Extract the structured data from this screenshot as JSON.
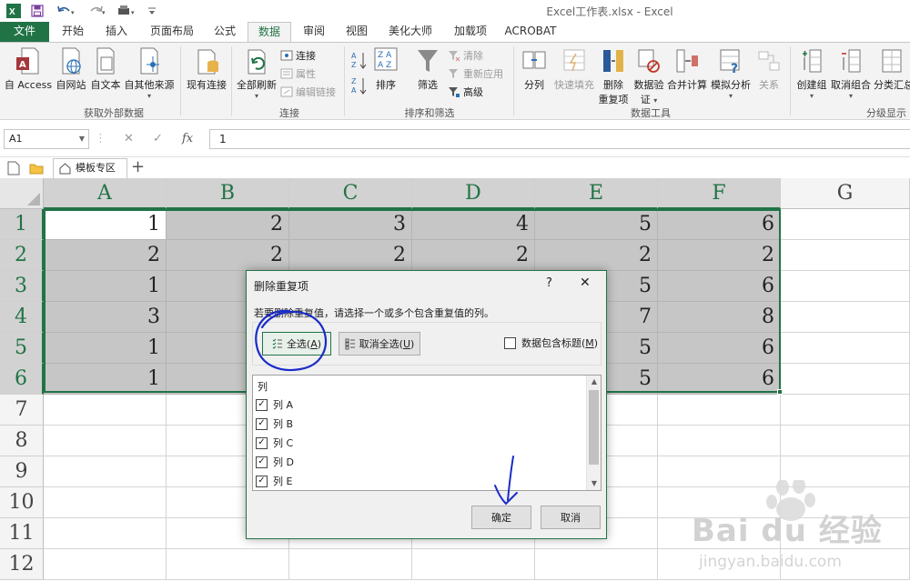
{
  "app": {
    "title": "Excel工作表.xlsx - Excel",
    "quick_access": [
      "save-icon",
      "undo-icon",
      "redo-icon",
      "print-preview-icon"
    ],
    "colors": {
      "brand": "#217346",
      "selection": "#c6c6c6",
      "annotation": "#1a2cc8"
    }
  },
  "ribbon_tabs": [
    {
      "label": "文件"
    },
    {
      "label": "开始"
    },
    {
      "label": "插入"
    },
    {
      "label": "页面布局"
    },
    {
      "label": "公式"
    },
    {
      "label": "数据",
      "active": true
    },
    {
      "label": "审阅"
    },
    {
      "label": "视图"
    },
    {
      "label": "美化大师"
    },
    {
      "label": "加载项"
    },
    {
      "label": "ACROBAT"
    }
  ],
  "ribbon": {
    "get_external": {
      "label": "获取外部数据",
      "buttons": [
        "自 Access",
        "自网站",
        "自文本",
        "自其他来源"
      ],
      "existing": "现有连接"
    },
    "connections": {
      "label": "连接",
      "refresh_all": "全部刷新",
      "connect": "连接",
      "properties": "属性",
      "edit_links": "编辑链接"
    },
    "sort_filter": {
      "label": "排序和筛选",
      "sort": "排序",
      "filter": "筛选",
      "clear": "清除",
      "reapply": "重新应用",
      "advanced": "高级"
    },
    "data_tools": {
      "label": "数据工具",
      "text_to_columns": "分列",
      "flash_fill": "快速填充",
      "remove_dup_1": "删除",
      "remove_dup_2": "重复项",
      "validation_1": "数据验",
      "validation_2": "证",
      "consolidate": "合并计算",
      "what_if": "模拟分析",
      "relationships": "关系"
    },
    "outline": {
      "label": "分级显示",
      "group": "创建组",
      "ungroup": "取消组合",
      "subtotal": "分类汇总"
    }
  },
  "formula_bar": {
    "name_box": "A1",
    "formula": "1"
  },
  "doc_tab": {
    "label": "模板专区"
  },
  "sheet": {
    "columns": [
      "A",
      "B",
      "C",
      "D",
      "E",
      "F",
      "G"
    ],
    "rows": [
      "1",
      "2",
      "3",
      "4",
      "5",
      "6",
      "7",
      "8",
      "9",
      "10",
      "11",
      "12"
    ],
    "cells": [
      [
        "1",
        "2",
        "3",
        "4",
        "5",
        "6"
      ],
      [
        "2",
        "2",
        "2",
        "2",
        "2",
        "2"
      ],
      [
        "1",
        "",
        "",
        "",
        "5",
        "6"
      ],
      [
        "3",
        "",
        "",
        "",
        "7",
        "8"
      ],
      [
        "1",
        "",
        "",
        "",
        "5",
        "6"
      ],
      [
        "1",
        "",
        "",
        "",
        "5",
        "6"
      ]
    ]
  },
  "dialog": {
    "title": "删除重复项",
    "help": "?",
    "prompt": "若要删除重复值，请选择一个或多个包含重复值的列。",
    "select_all": "全选(",
    "select_all_key": "A",
    "select_all_end": ")",
    "unselect_all": "取消全选(",
    "unselect_all_key": "U",
    "unselect_all_end": ")",
    "has_headers_label": "数据包含标题(",
    "has_headers_key": "M",
    "has_headers_end": ")",
    "has_headers_checked": false,
    "list_header": "列",
    "columns": [
      {
        "label": "列 A",
        "checked": true
      },
      {
        "label": "列 B",
        "checked": true
      },
      {
        "label": "列 C",
        "checked": true
      },
      {
        "label": "列 D",
        "checked": true
      },
      {
        "label": "列 E",
        "checked": true
      }
    ],
    "ok": "确定",
    "cancel": "取消"
  },
  "watermark": {
    "brand": "Bai du 经验",
    "url": "jingyan.baidu.com"
  }
}
